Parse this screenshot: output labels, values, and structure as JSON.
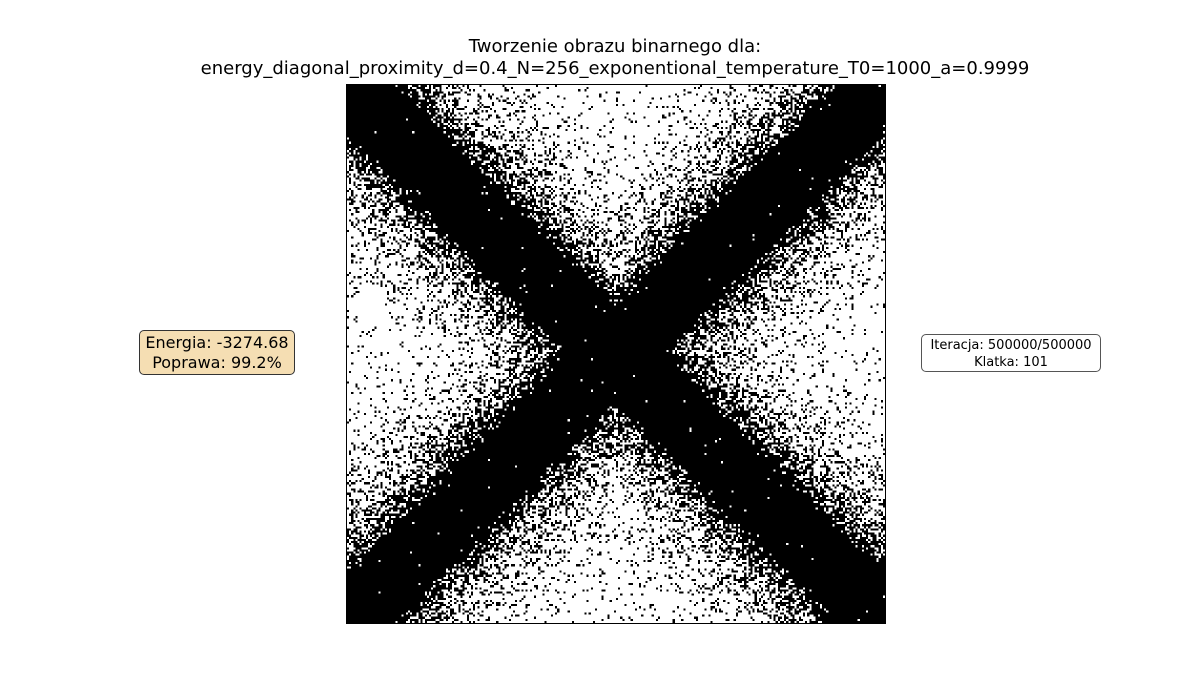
{
  "title": {
    "line1": "Tworzenie obrazu binarnego dla:",
    "line2": "energy_diagonal_proximity_d=0.4_N=256_exponentional_temperature_T0=1000_a=0.9999"
  },
  "energy_box": {
    "energy_text": "Energia: -3274.68",
    "improvement_text": "Poprawa: 99.2%",
    "background_color": "#f5deb3"
  },
  "iteration_box": {
    "iteration_text": "Iteracja: 500000/500000",
    "frame_text": "Klatka: 101"
  },
  "image": {
    "grid_size": 256,
    "pattern": "binary diagonal X (both diagonals dark), noisy scatter off-diagonal",
    "colors": {
      "on": "#000000",
      "off": "#ffffff"
    }
  }
}
